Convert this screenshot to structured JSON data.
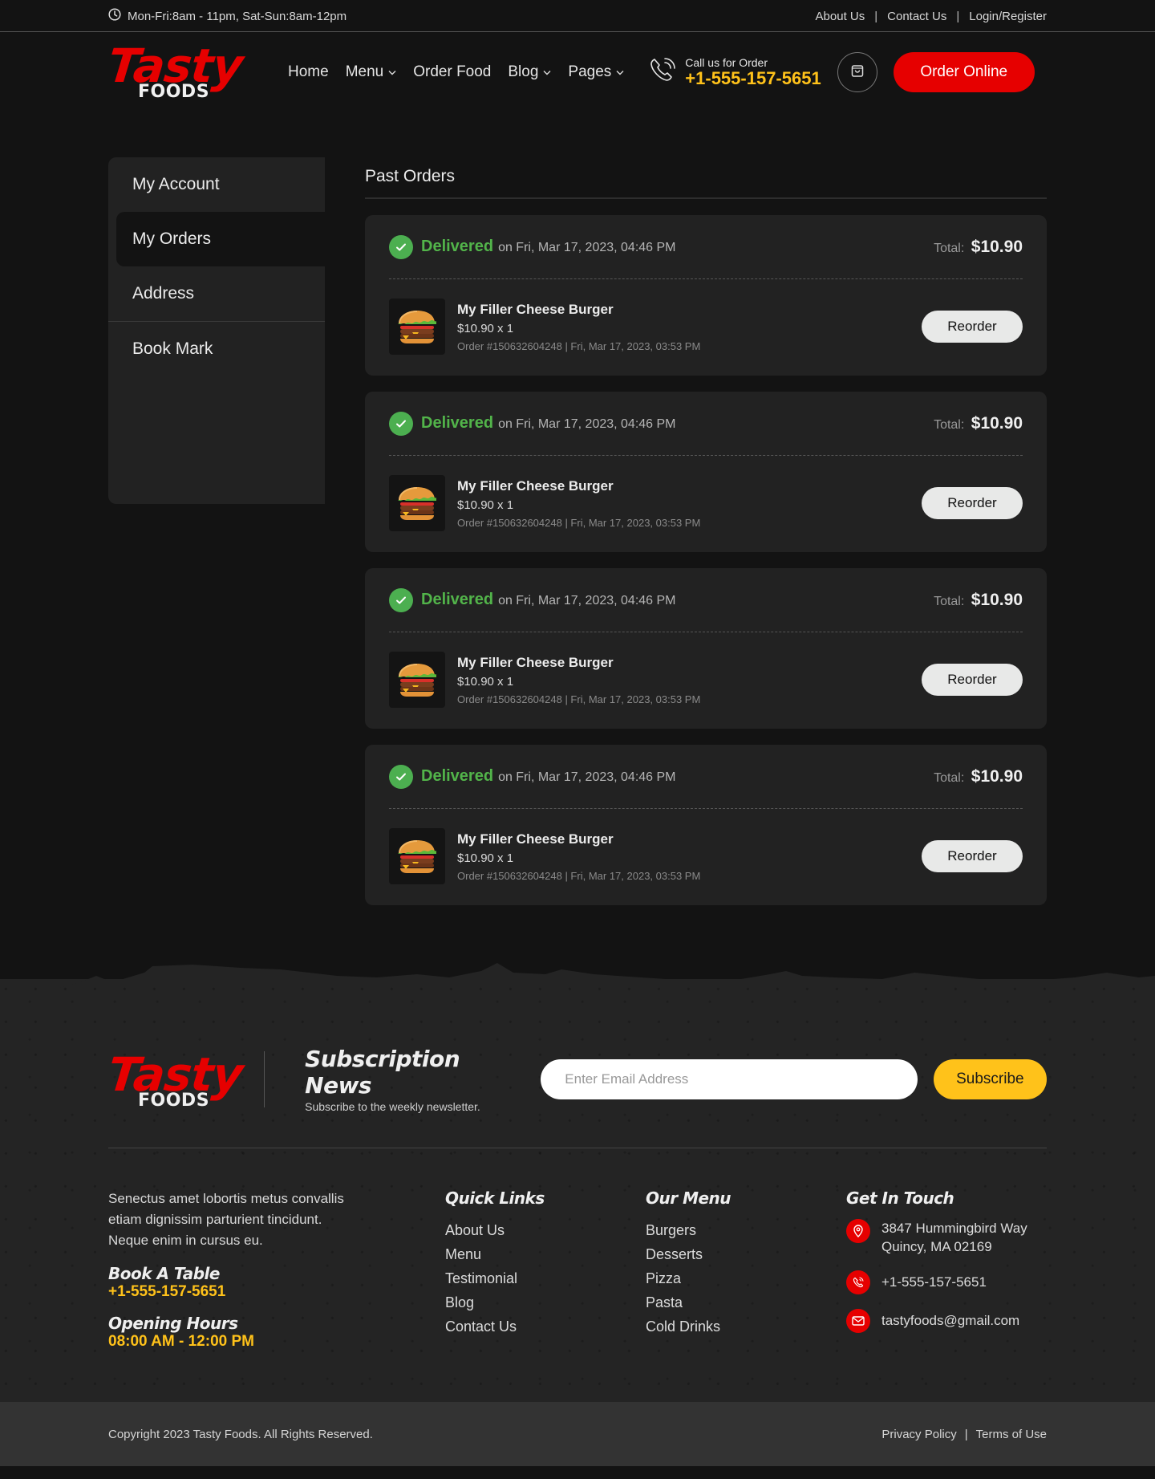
{
  "topbar": {
    "hours_icon": "clock-icon",
    "hours": "Mon-Fri:8am - 11pm, Sat-Sun:8am-12pm",
    "links": [
      "About Us",
      "Contact Us",
      "Login/Register"
    ],
    "separator": "|"
  },
  "brand": {
    "name_top": "Tasty",
    "name_bottom": "FOODS",
    "accent_color": "#e60000",
    "highlight_color": "#ffc21a"
  },
  "nav": {
    "items": [
      {
        "label": "Home",
        "has_dropdown": false
      },
      {
        "label": "Menu",
        "has_dropdown": true
      },
      {
        "label": "Order Food",
        "has_dropdown": false
      },
      {
        "label": "Blog",
        "has_dropdown": true
      },
      {
        "label": "Pages",
        "has_dropdown": true
      }
    ],
    "dropdown_glyph": "⌄",
    "call_icon": "phone-ringing-icon",
    "call_label": "Call us for Order",
    "call_number": "+1-555-157-5651",
    "cart_icon": "shopping-bag-icon",
    "order_online": "Order Online"
  },
  "sidebar": {
    "items": [
      {
        "label": "My Account",
        "active": false
      },
      {
        "label": "My Orders",
        "active": true
      },
      {
        "label": "Address",
        "active": false
      },
      {
        "label": "Book Mark",
        "active": false
      }
    ]
  },
  "orders": {
    "title": "Past Orders",
    "list": [
      {
        "status": "Delivered",
        "delivered_on": "on Fri, Mar 17, 2023, 04:46 PM",
        "total_label": "Total:",
        "total": "$10.90",
        "item_name": "My Filler Cheese Burger",
        "item_price": "$10.90 x 1",
        "meta": "Order #150632604248 | Fri, Mar 17, 2023, 03:53 PM",
        "reorder": "Reorder"
      },
      {
        "status": "Delivered",
        "delivered_on": "on Fri, Mar 17, 2023, 04:46 PM",
        "total_label": "Total:",
        "total": "$10.90",
        "item_name": "My Filler Cheese Burger",
        "item_price": "$10.90 x 1",
        "meta": "Order #150632604248 | Fri, Mar 17, 2023, 03:53 PM",
        "reorder": "Reorder"
      },
      {
        "status": "Delivered",
        "delivered_on": "on Fri, Mar 17, 2023, 04:46 PM",
        "total_label": "Total:",
        "total": "$10.90",
        "item_name": "My Filler Cheese Burger",
        "item_price": "$10.90 x 1",
        "meta": "Order #150632604248 | Fri, Mar 17, 2023, 03:53 PM",
        "reorder": "Reorder"
      },
      {
        "status": "Delivered",
        "delivered_on": "on Fri, Mar 17, 2023, 04:46 PM",
        "total_label": "Total:",
        "total": "$10.90",
        "item_name": "My Filler Cheese Burger",
        "item_price": "$10.90 x 1",
        "meta": "Order #150632604248 | Fri, Mar 17, 2023, 03:53 PM",
        "reorder": "Reorder"
      }
    ]
  },
  "footer": {
    "subscribe_title": "Subscription News",
    "subscribe_sub": "Subscribe to the weekly newsletter.",
    "email_placeholder": "Enter Email Address",
    "subscribe_button": "Subscribe",
    "about": "Senectus amet lobortis metus convallis etiam dignissim parturient tincidunt. Neque enim in cursus eu.",
    "book_title": "Book A Table",
    "book_phone": "+1-555-157-5651",
    "hours_title": "Opening Hours",
    "hours_value": "08:00 AM - 12:00 PM",
    "quick_links_title": "Quick Links",
    "quick_links": [
      "About Us",
      "Menu",
      "Testimonial",
      "Blog",
      "Contact Us"
    ],
    "menu_title": "Our Menu",
    "menu_links": [
      "Burgers",
      "Desserts",
      "Pizza",
      "Pasta",
      "Cold Drinks"
    ],
    "contact_title": "Get In Touch",
    "address_line1": "3847 Hummingbird Way",
    "address_line2": "Quincy, MA 02169",
    "phone": "+1-555-157-5651",
    "email": "tastyfoods@gmail.com",
    "copyright": "Copyright 2023 Tasty Foods. All Rights Reserved.",
    "privacy": "Privacy Policy",
    "terms": "Terms of Use",
    "legal_sep": "|"
  }
}
